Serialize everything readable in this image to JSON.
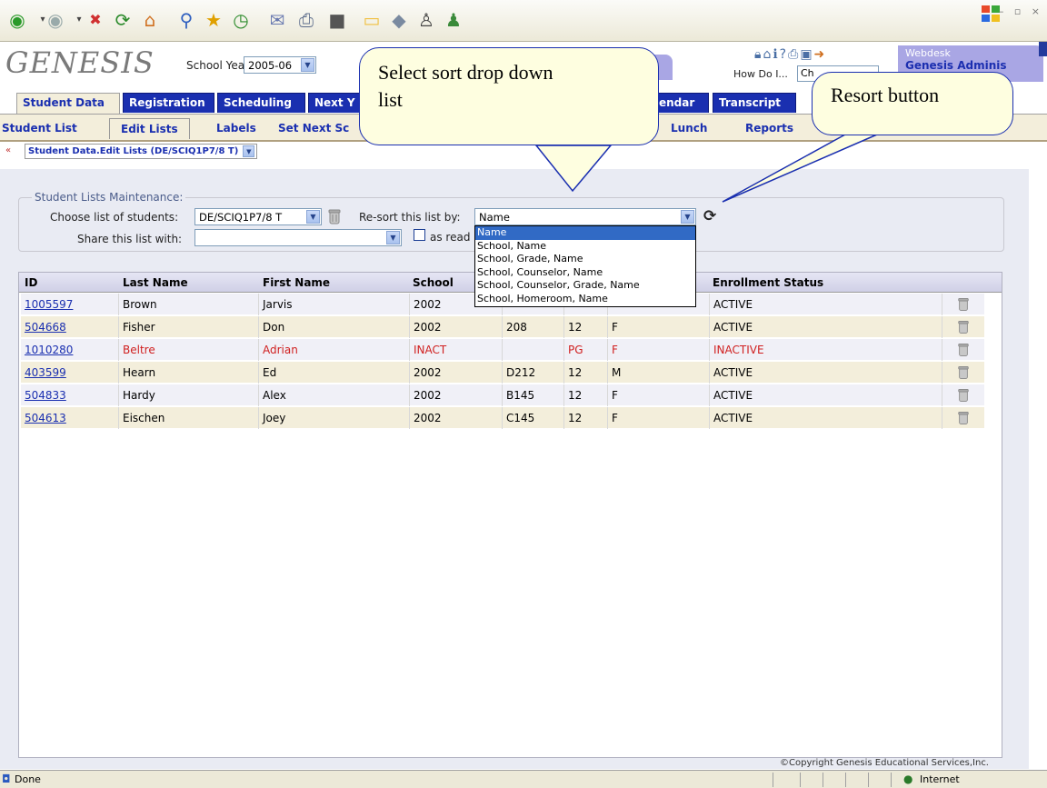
{
  "browser": {
    "toolbar_icons": [
      "back-icon",
      "forward-icon",
      "stop-icon",
      "refresh-icon",
      "home-icon",
      "search-icon",
      "favorites-icon",
      "history-icon",
      "mail-icon",
      "print-icon",
      "edit-icon",
      "folder-icon",
      "messenger-icon",
      "contacts-icon",
      "users-icon"
    ],
    "window_controls": "– ▫ ×",
    "status_text": "Done",
    "zone_text": "Internet"
  },
  "app": {
    "logo": "GENESIS",
    "school_year_label": "School Year:",
    "school_year_value": "2005-06",
    "how_do_i_label": "How Do I...",
    "how_do_i_value": "Ch",
    "webdesk_line1": "Webdesk",
    "webdesk_line2": "Genesis Adminis"
  },
  "main_tabs": [
    {
      "label": "Student Data",
      "active": true
    },
    {
      "label": "Registration",
      "active": false
    },
    {
      "label": "Scheduling",
      "active": false
    },
    {
      "label": "Next Y",
      "active": false
    },
    {
      "label": "endar",
      "active": false
    },
    {
      "label": "Transcript",
      "active": false
    }
  ],
  "sub_tabs": [
    {
      "label": "Student List",
      "active": false
    },
    {
      "label": "Edit Lists",
      "active": true
    },
    {
      "label": "Labels",
      "active": false
    },
    {
      "label": "Set Next Sc",
      "active": false
    },
    {
      "label": "Lunch",
      "active": false
    },
    {
      "label": "Reports",
      "active": false
    }
  ],
  "breadcrumb": "Student Data.Edit Lists (DE/SCIQ1P7/8 T)",
  "maintenance": {
    "legend": "Student Lists Maintenance:",
    "choose_label": "Choose list of students:",
    "choose_value": "DE/SCIQ1P7/8 T",
    "resort_label": "Re-sort this list by:",
    "resort_value": "Name",
    "share_label": "Share this list with:",
    "share_value": "",
    "readonly_label": "as read"
  },
  "sort_options": [
    "Name",
    "School, Name",
    "School, Grade, Name",
    "School, Counselor, Name",
    "School, Counselor, Grade, Name",
    "School, Homeroom, Name"
  ],
  "table": {
    "headers": [
      "ID",
      "Last Name",
      "First Name",
      "School",
      "Enrollment Status"
    ],
    "rows": [
      {
        "id": "1005597",
        "last": "Brown",
        "first": "Jarvis",
        "school": "2002",
        "room": "",
        "grade": "",
        "gender": "",
        "status": "ACTIVE",
        "inactive": false
      },
      {
        "id": "504668",
        "last": "Fisher",
        "first": "Don",
        "school": "2002",
        "room": "208",
        "grade": "12",
        "gender": "F",
        "status": "ACTIVE",
        "inactive": false
      },
      {
        "id": "1010280",
        "last": "Beltre",
        "first": "Adrian",
        "school": "INACT",
        "room": "",
        "grade": "PG",
        "gender": "F",
        "status": "INACTIVE",
        "inactive": true
      },
      {
        "id": "403599",
        "last": "Hearn",
        "first": "Ed",
        "school": "2002",
        "room": "D212",
        "grade": "12",
        "gender": "M",
        "status": "ACTIVE",
        "inactive": false
      },
      {
        "id": "504833",
        "last": "Hardy",
        "first": "Alex",
        "school": "2002",
        "room": "B145",
        "grade": "12",
        "gender": "F",
        "status": "ACTIVE",
        "inactive": false
      },
      {
        "id": "504613",
        "last": "Eischen",
        "first": "Joey",
        "school": "2002",
        "room": "C145",
        "grade": "12",
        "gender": "F",
        "status": "ACTIVE",
        "inactive": false
      }
    ]
  },
  "copyright": "©Copyright Genesis Educational Services,Inc.",
  "callouts": {
    "sort_dropdown": "Select sort drop down list",
    "resort_button": "Resort button"
  },
  "colors": {
    "tab_blue": "#1a2fb0",
    "row_odd": "#f0f0f7",
    "row_even": "#f3eedb",
    "inactive_red": "#d02020",
    "callout_bg": "#fefee0"
  }
}
